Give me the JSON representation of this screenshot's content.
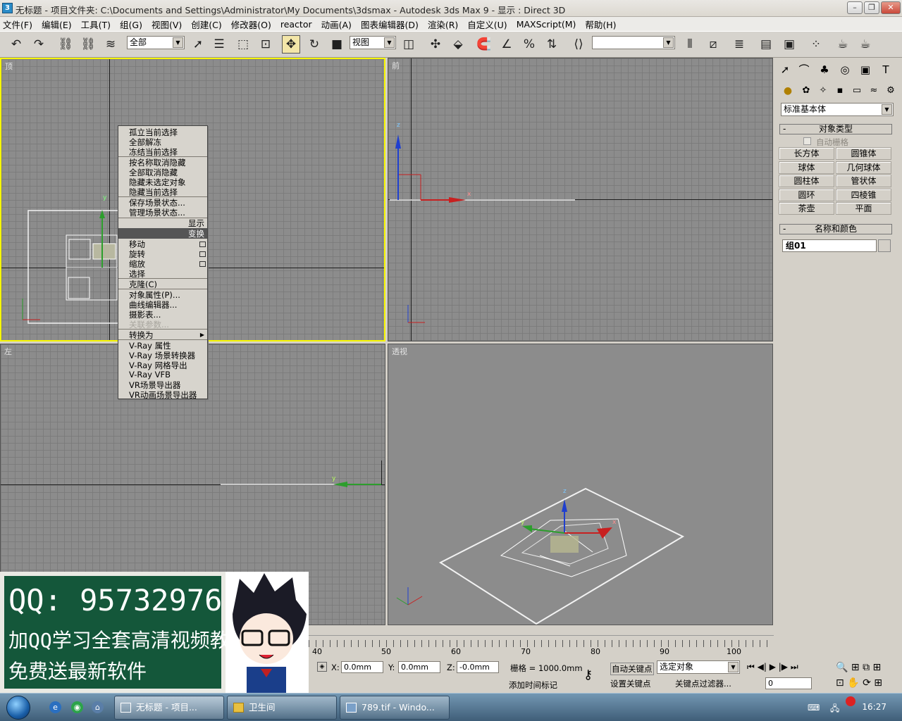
{
  "window": {
    "title": "无标题      - 项目文件夹: C:\\Documents and Settings\\Administrator\\My Documents\\3dsmax      - Autodesk 3ds Max 9      - 显示 : Direct 3D",
    "app_icon": "3"
  },
  "menu": [
    "文件(F)",
    "编辑(E)",
    "工具(T)",
    "组(G)",
    "视图(V)",
    "创建(C)",
    "修改器(O)",
    "reactor",
    "动画(A)",
    "图表编辑器(D)",
    "渲染(R)",
    "自定义(U)",
    "MAXScript(M)",
    "帮助(H)"
  ],
  "toolbar": {
    "selection_filter": "全部",
    "ref_coord": "视图",
    "named_selection": ""
  },
  "viewports": {
    "top": "顶",
    "front": "前",
    "left": "左",
    "persp": "透视"
  },
  "axes": {
    "x": "x",
    "y": "y",
    "z": "z"
  },
  "quad_menu": {
    "display_items": [
      "孤立当前选择",
      "全部解冻",
      "冻结当前选择",
      "按名称取消隐藏",
      "全部取消隐藏",
      "隐藏未选定对象",
      "隐藏当前选择",
      "保存场景状态...",
      "管理场景状态..."
    ],
    "display_header": "显示",
    "transform_header": "变换",
    "transform_items": [
      "移动",
      "旋转",
      "缩放",
      "选择",
      "克隆(C)",
      "对象属性(P)...",
      "曲线编辑器...",
      "摄影表...",
      "关联参数..."
    ],
    "extra_items": [
      "转换为",
      "V-Ray 属性",
      "V-Ray 场景转换器",
      "V-Ray 网格导出",
      "V-Ray VFB",
      "VR场景导出器",
      "VR动画场景导出器"
    ]
  },
  "command_panel": {
    "category": "标准基本体",
    "rollout_object_type": "对象类型",
    "auto_grid": "自动栅格",
    "primitives": [
      "长方体",
      "圆锥体",
      "球体",
      "几何球体",
      "圆柱体",
      "管状体",
      "圆环",
      "四棱锥",
      "茶壶",
      "平面"
    ],
    "rollout_name_color": "名称和颜色",
    "object_name": "组01"
  },
  "overlay": {
    "qq": "QQ: 95732976",
    "line1": "加QQ学习全套高清视频教程",
    "line2": "免费送最新软件"
  },
  "timeline": {
    "ticks": [
      "40",
      "50",
      "60",
      "70",
      "80",
      "90",
      "100"
    ]
  },
  "status": {
    "x_label": "X:",
    "x_val": "0.0mm",
    "y_label": "Y:",
    "y_val": "0.0mm",
    "z_label": "Z:",
    "z_val": "-0.0mm",
    "grid": "栅格 = 1000.0mm",
    "add_tag": "添加时间标记",
    "auto_key": "自动关键点",
    "set_key": "设置关键点",
    "key_mode": "选定对象",
    "key_filter": "关键点过滤器...",
    "frame": "0"
  },
  "taskbar": {
    "tasks": [
      "无标题      - 项目...",
      "卫生间",
      "789.tif - Windo..."
    ],
    "clock": "16:27"
  }
}
